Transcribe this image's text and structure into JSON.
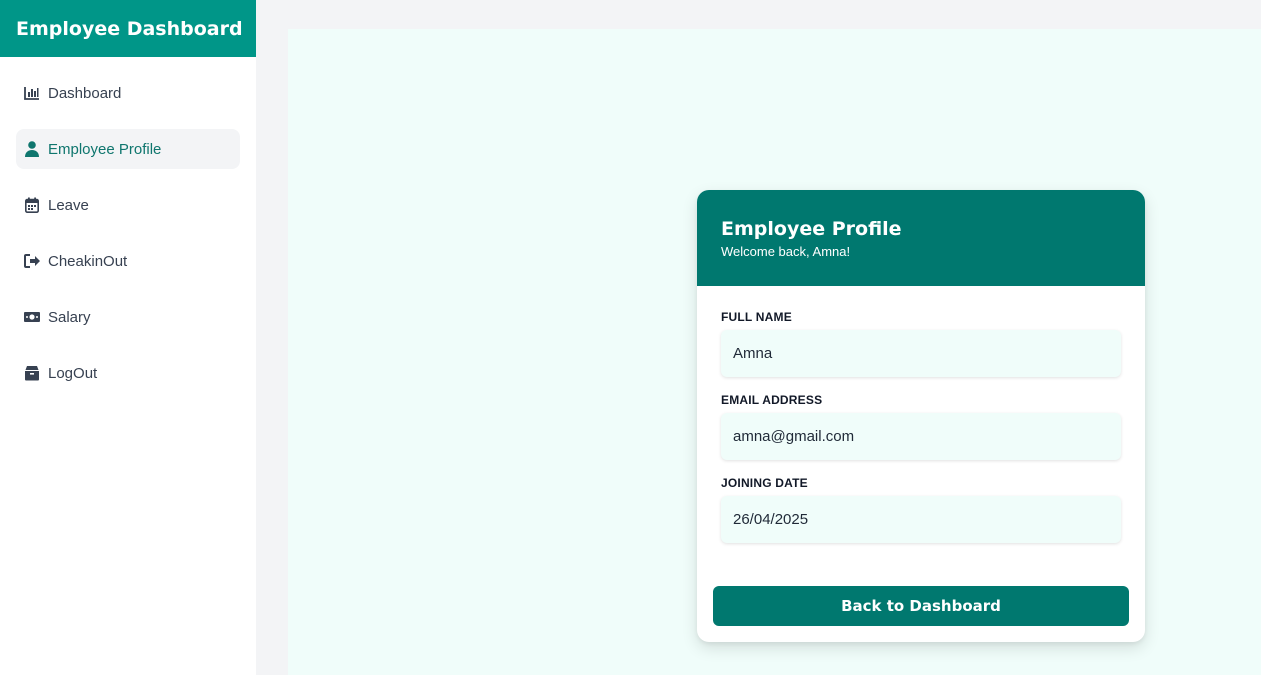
{
  "app": {
    "title": "Employee Dashboard"
  },
  "sidebar": {
    "items": [
      {
        "label": "Dashboard",
        "icon": "bar-chart-icon",
        "active": false
      },
      {
        "label": "Employee Profile",
        "icon": "user-icon",
        "active": true
      },
      {
        "label": "Leave",
        "icon": "calendar-icon",
        "active": false
      },
      {
        "label": "CheakinOut",
        "icon": "sign-out-icon",
        "active": false
      },
      {
        "label": "Salary",
        "icon": "money-bill-icon",
        "active": false
      },
      {
        "label": "LogOut",
        "icon": "box-icon",
        "active": false
      }
    ]
  },
  "profile": {
    "title": "Employee Profile",
    "welcome": "Welcome back, Amna!",
    "fields": [
      {
        "label": "FULL NAME",
        "value": "Amna"
      },
      {
        "label": "EMAIL ADDRESS",
        "value": "amna@gmail.com"
      },
      {
        "label": "JOINING DATE",
        "value": "26/04/2025"
      }
    ],
    "back_button": "Back to Dashboard"
  },
  "colors": {
    "brand": "#009688",
    "card_header": "#00786f",
    "accent_text": "#0f766e",
    "main_bg": "#f0fdfa"
  }
}
